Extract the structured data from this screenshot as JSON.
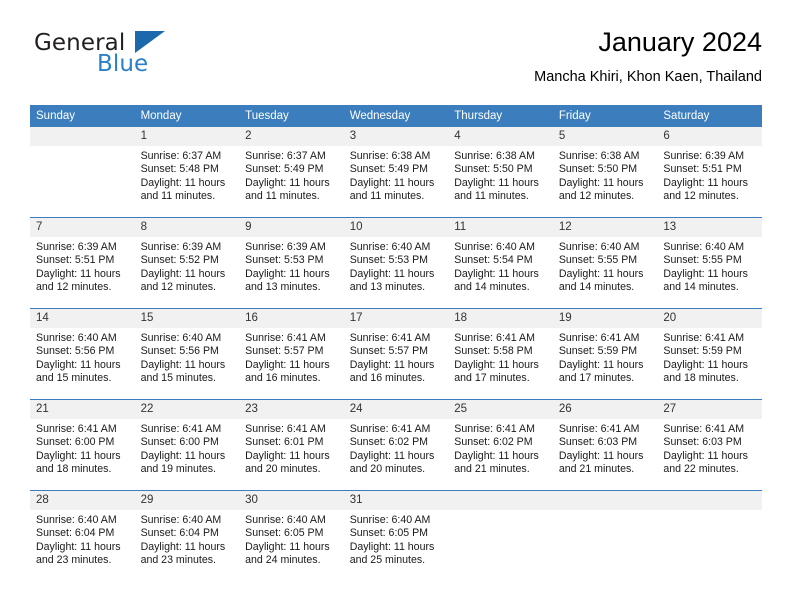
{
  "brand": {
    "name_part1": "General",
    "name_part2": "Blue",
    "accent_color": "#2a7fc9",
    "triangle_color": "#1b68ad"
  },
  "header": {
    "title": "January 2024",
    "subtitle": "Mancha Khiri, Khon Kaen, Thailand"
  },
  "calendar": {
    "header_color": "#3b7dbd",
    "daynum_bg": "#f1f1f1",
    "weekdays": [
      "Sunday",
      "Monday",
      "Tuesday",
      "Wednesday",
      "Thursday",
      "Friday",
      "Saturday"
    ],
    "weeks": [
      [
        {
          "day": "",
          "empty": true,
          "sunrise": "",
          "sunset": "",
          "daylight": ""
        },
        {
          "day": "1",
          "sunrise": "Sunrise: 6:37 AM",
          "sunset": "Sunset: 5:48 PM",
          "daylight": "Daylight: 11 hours and 11 minutes."
        },
        {
          "day": "2",
          "sunrise": "Sunrise: 6:37 AM",
          "sunset": "Sunset: 5:49 PM",
          "daylight": "Daylight: 11 hours and 11 minutes."
        },
        {
          "day": "3",
          "sunrise": "Sunrise: 6:38 AM",
          "sunset": "Sunset: 5:49 PM",
          "daylight": "Daylight: 11 hours and 11 minutes."
        },
        {
          "day": "4",
          "sunrise": "Sunrise: 6:38 AM",
          "sunset": "Sunset: 5:50 PM",
          "daylight": "Daylight: 11 hours and 11 minutes."
        },
        {
          "day": "5",
          "sunrise": "Sunrise: 6:38 AM",
          "sunset": "Sunset: 5:50 PM",
          "daylight": "Daylight: 11 hours and 12 minutes."
        },
        {
          "day": "6",
          "sunrise": "Sunrise: 6:39 AM",
          "sunset": "Sunset: 5:51 PM",
          "daylight": "Daylight: 11 hours and 12 minutes."
        }
      ],
      [
        {
          "day": "7",
          "sunrise": "Sunrise: 6:39 AM",
          "sunset": "Sunset: 5:51 PM",
          "daylight": "Daylight: 11 hours and 12 minutes."
        },
        {
          "day": "8",
          "sunrise": "Sunrise: 6:39 AM",
          "sunset": "Sunset: 5:52 PM",
          "daylight": "Daylight: 11 hours and 12 minutes."
        },
        {
          "day": "9",
          "sunrise": "Sunrise: 6:39 AM",
          "sunset": "Sunset: 5:53 PM",
          "daylight": "Daylight: 11 hours and 13 minutes."
        },
        {
          "day": "10",
          "sunrise": "Sunrise: 6:40 AM",
          "sunset": "Sunset: 5:53 PM",
          "daylight": "Daylight: 11 hours and 13 minutes."
        },
        {
          "day": "11",
          "sunrise": "Sunrise: 6:40 AM",
          "sunset": "Sunset: 5:54 PM",
          "daylight": "Daylight: 11 hours and 14 minutes."
        },
        {
          "day": "12",
          "sunrise": "Sunrise: 6:40 AM",
          "sunset": "Sunset: 5:55 PM",
          "daylight": "Daylight: 11 hours and 14 minutes."
        },
        {
          "day": "13",
          "sunrise": "Sunrise: 6:40 AM",
          "sunset": "Sunset: 5:55 PM",
          "daylight": "Daylight: 11 hours and 14 minutes."
        }
      ],
      [
        {
          "day": "14",
          "sunrise": "Sunrise: 6:40 AM",
          "sunset": "Sunset: 5:56 PM",
          "daylight": "Daylight: 11 hours and 15 minutes."
        },
        {
          "day": "15",
          "sunrise": "Sunrise: 6:40 AM",
          "sunset": "Sunset: 5:56 PM",
          "daylight": "Daylight: 11 hours and 15 minutes."
        },
        {
          "day": "16",
          "sunrise": "Sunrise: 6:41 AM",
          "sunset": "Sunset: 5:57 PM",
          "daylight": "Daylight: 11 hours and 16 minutes."
        },
        {
          "day": "17",
          "sunrise": "Sunrise: 6:41 AM",
          "sunset": "Sunset: 5:57 PM",
          "daylight": "Daylight: 11 hours and 16 minutes."
        },
        {
          "day": "18",
          "sunrise": "Sunrise: 6:41 AM",
          "sunset": "Sunset: 5:58 PM",
          "daylight": "Daylight: 11 hours and 17 minutes."
        },
        {
          "day": "19",
          "sunrise": "Sunrise: 6:41 AM",
          "sunset": "Sunset: 5:59 PM",
          "daylight": "Daylight: 11 hours and 17 minutes."
        },
        {
          "day": "20",
          "sunrise": "Sunrise: 6:41 AM",
          "sunset": "Sunset: 5:59 PM",
          "daylight": "Daylight: 11 hours and 18 minutes."
        }
      ],
      [
        {
          "day": "21",
          "sunrise": "Sunrise: 6:41 AM",
          "sunset": "Sunset: 6:00 PM",
          "daylight": "Daylight: 11 hours and 18 minutes."
        },
        {
          "day": "22",
          "sunrise": "Sunrise: 6:41 AM",
          "sunset": "Sunset: 6:00 PM",
          "daylight": "Daylight: 11 hours and 19 minutes."
        },
        {
          "day": "23",
          "sunrise": "Sunrise: 6:41 AM",
          "sunset": "Sunset: 6:01 PM",
          "daylight": "Daylight: 11 hours and 20 minutes."
        },
        {
          "day": "24",
          "sunrise": "Sunrise: 6:41 AM",
          "sunset": "Sunset: 6:02 PM",
          "daylight": "Daylight: 11 hours and 20 minutes."
        },
        {
          "day": "25",
          "sunrise": "Sunrise: 6:41 AM",
          "sunset": "Sunset: 6:02 PM",
          "daylight": "Daylight: 11 hours and 21 minutes."
        },
        {
          "day": "26",
          "sunrise": "Sunrise: 6:41 AM",
          "sunset": "Sunset: 6:03 PM",
          "daylight": "Daylight: 11 hours and 21 minutes."
        },
        {
          "day": "27",
          "sunrise": "Sunrise: 6:41 AM",
          "sunset": "Sunset: 6:03 PM",
          "daylight": "Daylight: 11 hours and 22 minutes."
        }
      ],
      [
        {
          "day": "28",
          "sunrise": "Sunrise: 6:40 AM",
          "sunset": "Sunset: 6:04 PM",
          "daylight": "Daylight: 11 hours and 23 minutes."
        },
        {
          "day": "29",
          "sunrise": "Sunrise: 6:40 AM",
          "sunset": "Sunset: 6:04 PM",
          "daylight": "Daylight: 11 hours and 23 minutes."
        },
        {
          "day": "30",
          "sunrise": "Sunrise: 6:40 AM",
          "sunset": "Sunset: 6:05 PM",
          "daylight": "Daylight: 11 hours and 24 minutes."
        },
        {
          "day": "31",
          "sunrise": "Sunrise: 6:40 AM",
          "sunset": "Sunset: 6:05 PM",
          "daylight": "Daylight: 11 hours and 25 minutes."
        },
        {
          "day": "",
          "empty": true,
          "sunrise": "",
          "sunset": "",
          "daylight": ""
        },
        {
          "day": "",
          "empty": true,
          "sunrise": "",
          "sunset": "",
          "daylight": ""
        },
        {
          "day": "",
          "empty": true,
          "sunrise": "",
          "sunset": "",
          "daylight": ""
        }
      ]
    ]
  }
}
